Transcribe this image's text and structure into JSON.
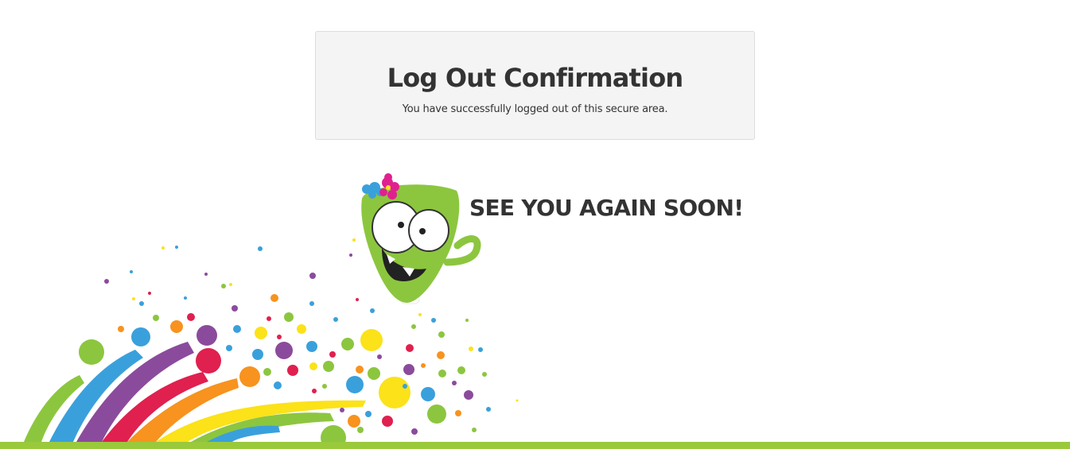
{
  "confirmation": {
    "title": "Log Out Confirmation",
    "message": "You have successfully logged out of this secure area."
  },
  "farewell": {
    "text": "SEE YOU AGAIN SOON!"
  },
  "decoration": {
    "mascot_icon": "green-monster-mascot-icon",
    "splash_icon": "rainbow-paint-splash-icon"
  },
  "colors": {
    "panel_background": "#f4f4f4",
    "text": "#333333",
    "brand_green": "#8cc63f",
    "bottom_bar": "#9ac93b",
    "splash_blue": "#3aa0dc",
    "splash_purple": "#8b4b9c",
    "splash_red": "#e0204f",
    "splash_orange": "#f7931e",
    "splash_yellow": "#fbe219"
  }
}
